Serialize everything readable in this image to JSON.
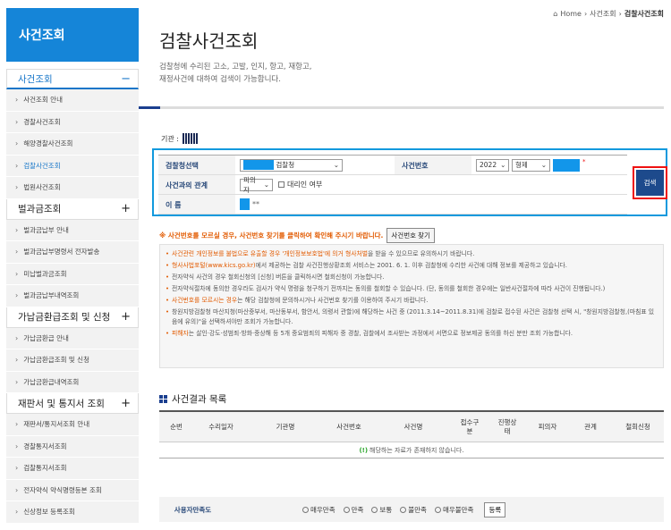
{
  "sidebar": {
    "title": "사건조회",
    "groups": [
      {
        "label": "사건조회",
        "sign": "−",
        "items": [
          "사건조회 안내",
          "경찰사건조회",
          "해양경찰사건조회",
          "검찰사건조회",
          "법원사건조회"
        ]
      },
      {
        "label": "벌과금조회",
        "sign": "+",
        "items": [
          "벌과금납부 안내",
          "벌과금납부명령서 전자발송",
          "미납벌과금조회",
          "벌과금납부내역조회"
        ]
      },
      {
        "label": "가납금환급조회 및 신청",
        "sign": "+",
        "items": [
          "가납금환급 안내",
          "가납금환급조회 및 신청",
          "가납금환급내역조회"
        ]
      },
      {
        "label": "재판서 및 통지서 조회",
        "sign": "+",
        "items": [
          "재판서/통지서조회 안내",
          "경찰통지서조회",
          "검찰통지서조회",
          "전자약식 약식명령등본 조회",
          "신상정보 등록조회"
        ]
      }
    ]
  },
  "breadcrumb": {
    "home": "Home",
    "mid": "사건조회",
    "current": "검찰사건조회"
  },
  "page": {
    "title": "검찰사건조회",
    "desc1": "검찰청에 수리된 고소, 고발, 인지, 항고, 재항고,",
    "desc2": "재정사건에 대하여 검색이 가능합니다."
  },
  "agency_label": "기관 :",
  "form": {
    "office_label": "검찰청선택",
    "office_value": "검찰청",
    "case_no_label": "사건번호",
    "year": "2022",
    "case_type": "형제",
    "relation_label": "사건과의 관계",
    "relation_value": "피의자",
    "proxy_label": "대리인 여부",
    "name_label": "이 름",
    "name_suffix": "**",
    "required_mark": "*",
    "search_button": "검색"
  },
  "notice": {
    "text": "※ 사건번호를 모르실 경우, 사건번호 찾기를 클릭하여 확인해 주시기 바랍니다.",
    "find_button": "사건번호 찾기"
  },
  "info": [
    {
      "hl": "사건관련 개인정보를 불법으로 유출할 경우 '개인정보보호법'에 의거 형사처벌",
      "text": "을 받을 수 있으므로 유의하시기 바랍니다."
    },
    {
      "hl": "형사사법포털(www.kics.go.kr)",
      "text": "에서 제공하는 검찰 사건진행상황조회 서비스는 2001. 6. 1. 이후 검찰청에 수리한 사건에 대해 정보를 제공하고 있습니다."
    },
    {
      "hl": "",
      "text": "전자약식 사건의 경우 철회신청의 [신청] 버튼을 클릭하시면 철회신청이 가능합니다."
    },
    {
      "hl": "",
      "text": "전자약식절차에 동의한 경우라도 검사가 약식 명령을 청구하기 전까지는 동의를 철회할 수 있습니다. (단, 동의를 철회한 경우에는 일반사건절차에 따라 사건이 진행됩니다.)"
    },
    {
      "hl": "사건번호를 모르시는 경우",
      "text": "는 해당 검찰청에 문의하시거나 사건번호 찾기를 이용하여 주시기 바랍니다."
    },
    {
      "hl": "",
      "text": "창원지방검찰청 마산지청(마산중부서, 마산동부서, 함안서, 의령서 관할)에 해당하는 사건 중 (2011.3.14~2011.8.31)에 검찰로 접수된 사건은 검찰청 선택 시, \"창원지방검찰청,(마침표 있음에 유의)\"을 선택하셔야만 조회가 가능합니다."
    },
    {
      "hl": "피해자",
      "text": "는 살인·강도·성범죄·방화·중상해 등 5개 중요범죄의 피해자 중 경찰, 검찰에서 조사받는 과정에서 서면으로 정보제공 동의를 하신 분만 조회 가능합니다."
    }
  ],
  "results": {
    "title": "사건결과 목록",
    "columns": [
      "순번",
      "수리일자",
      "기관명",
      "사건번호",
      "사건명",
      "접수구분",
      "진행상태",
      "피의자",
      "관계",
      "철회신청"
    ],
    "empty_mark": "(!)",
    "empty": "해당하는 자료가 존재하지 않습니다."
  },
  "satisfaction": {
    "label": "사용자만족도",
    "options": [
      "매우만족",
      "만족",
      "보통",
      "불만족",
      "매우불만족"
    ],
    "submit": "등록"
  },
  "colors": {
    "primary": "#1585d8",
    "navy": "#1d4a8c",
    "accent": "#e25a00",
    "highlight": "#e11111"
  }
}
